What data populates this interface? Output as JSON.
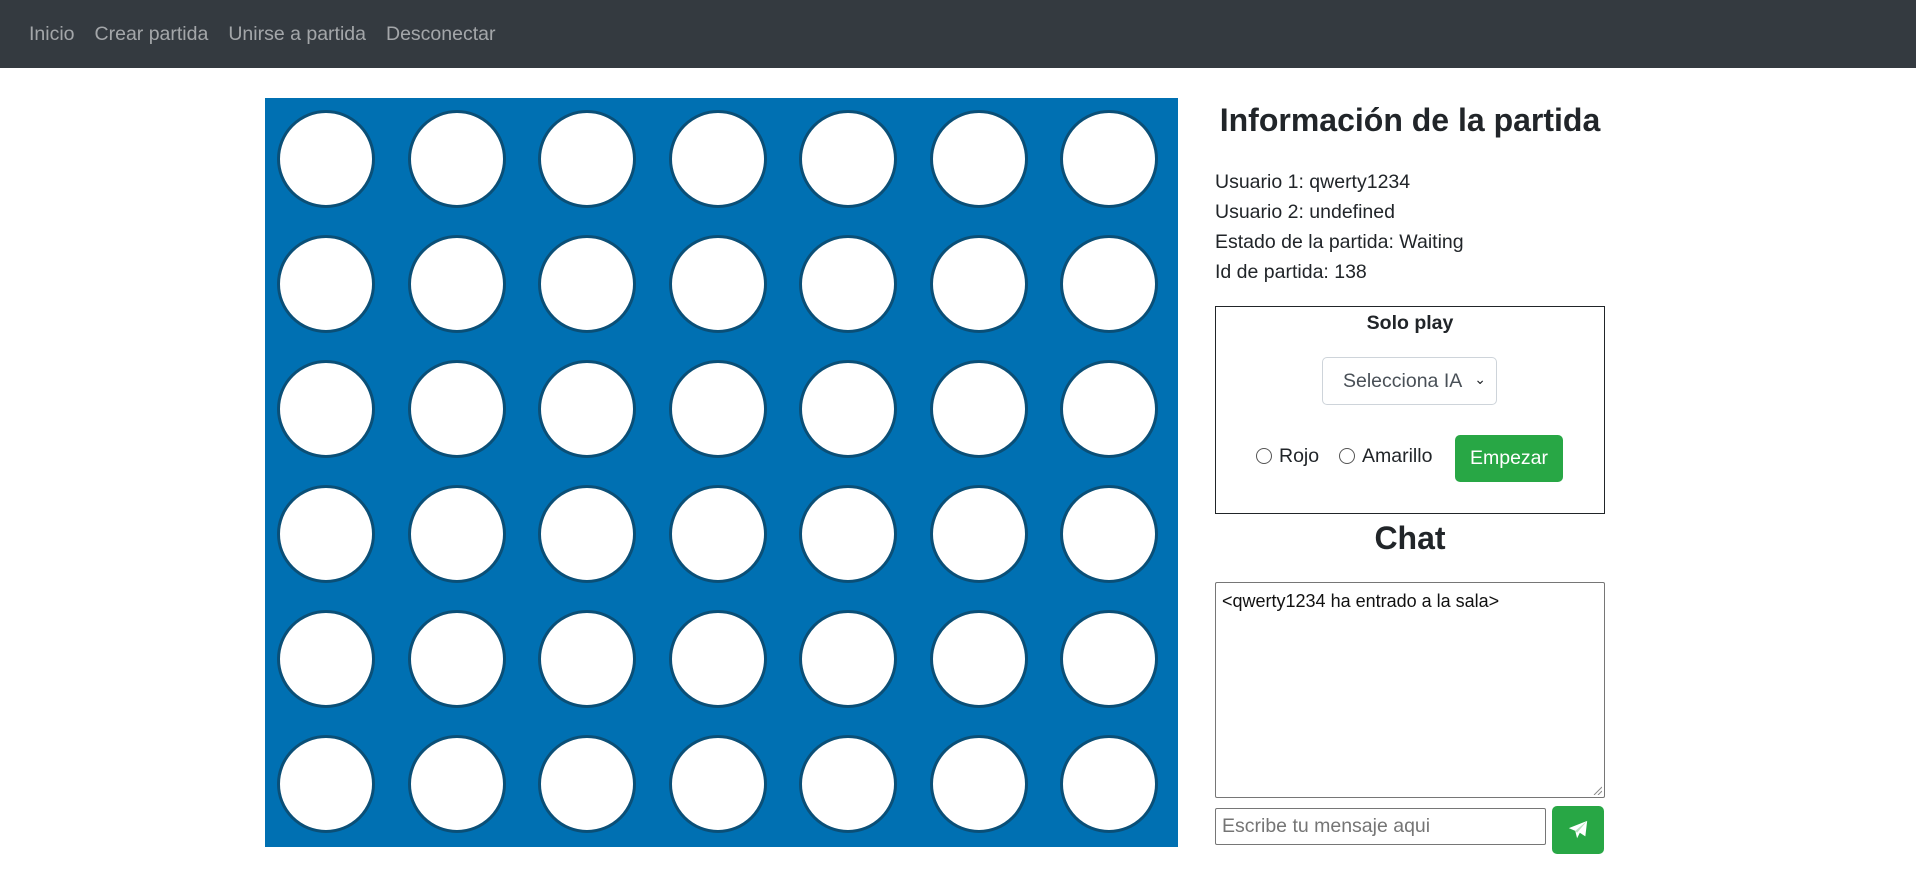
{
  "nav": {
    "items": [
      "Inicio",
      "Crear partida",
      "Unirse a partida",
      "Desconectar"
    ]
  },
  "board": {
    "rows": 6,
    "cols": 7,
    "colors": {
      "background": "#0070b2",
      "empty_cell": "#ffffff",
      "cell_border": "#0a4f77"
    }
  },
  "info": {
    "title": "Información de la partida",
    "usuario1": "Usuario 1: qwerty1234",
    "usuario2": "Usuario 2: undefined",
    "estado": "Estado de la partida: Waiting",
    "id": "Id de partida: 138"
  },
  "solo": {
    "title": "Solo play",
    "select_value": "Selecciona IA",
    "radio_rojo": "Rojo",
    "radio_amarillo": "Amarillo",
    "start_button": "Empezar"
  },
  "chat": {
    "title": "Chat",
    "log": "<qwerty1234 ha entrado a la sala>",
    "input_placeholder": "Escribe tu mensaje aqui",
    "send_icon": "paper-plane-icon"
  },
  "colors": {
    "navbar": "#343a40",
    "accent_green": "#28a745"
  }
}
